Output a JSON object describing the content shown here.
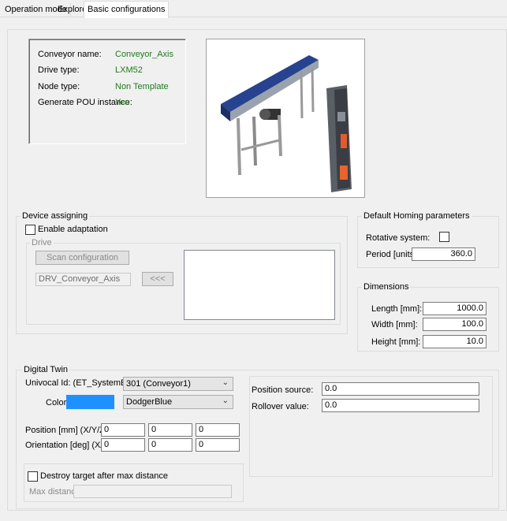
{
  "tabs": [
    "Operation mode",
    "Explorer",
    "Basic configurations"
  ],
  "info": {
    "conveyor_name_label": "Conveyor name:",
    "conveyor_name_value": "Conveyor_Axis",
    "drive_type_label": "Drive type:",
    "drive_type_value": "LXM52",
    "node_type_label": "Node type:",
    "node_type_value": "Non Template",
    "generate_pou_label": "Generate POU instance:",
    "generate_pou_value": "Yes"
  },
  "device_assigning": {
    "title": "Device assigning",
    "enable_adaptation": "Enable adaptation",
    "drive_group": "Drive",
    "scan_button": "Scan configuration",
    "drive_field": "DRV_Conveyor_Axis",
    "assign_button": "<<<"
  },
  "homing": {
    "title": "Default Homing parameters",
    "rotative_label": "Rotative system:",
    "period_label": "Period [units]:",
    "period_value": "360.0"
  },
  "dimensions": {
    "title": "Dimensions",
    "length_label": "Length [mm]:",
    "length_value": "1000.0",
    "width_label": "Width [mm]:",
    "width_value": "100.0",
    "height_label": "Height [mm]:",
    "height_value": "10.0"
  },
  "digital_twin": {
    "title": "Digital Twin",
    "univocal_label": "Univocal Id: (ET_SystemEntity)",
    "univocal_value": "301 (Conveyor1)",
    "color_label": "Color:",
    "color_hex": "#1E90FF",
    "color_value": "DodgerBlue",
    "position_label": "Position [mm] (X/Y/Z):",
    "position_values": [
      "0",
      "0",
      "0"
    ],
    "orientation_label": "Orientation [deg] (X/Y/Z):",
    "orientation_values": [
      "0",
      "0",
      "0"
    ],
    "destroy_label": "Destroy target after max distance",
    "max_distance_label": "Max distance:",
    "position_source_label": "Position source:",
    "position_source_value": "0.0",
    "rollover_label": "Rollover value:",
    "rollover_value": "0.0"
  }
}
